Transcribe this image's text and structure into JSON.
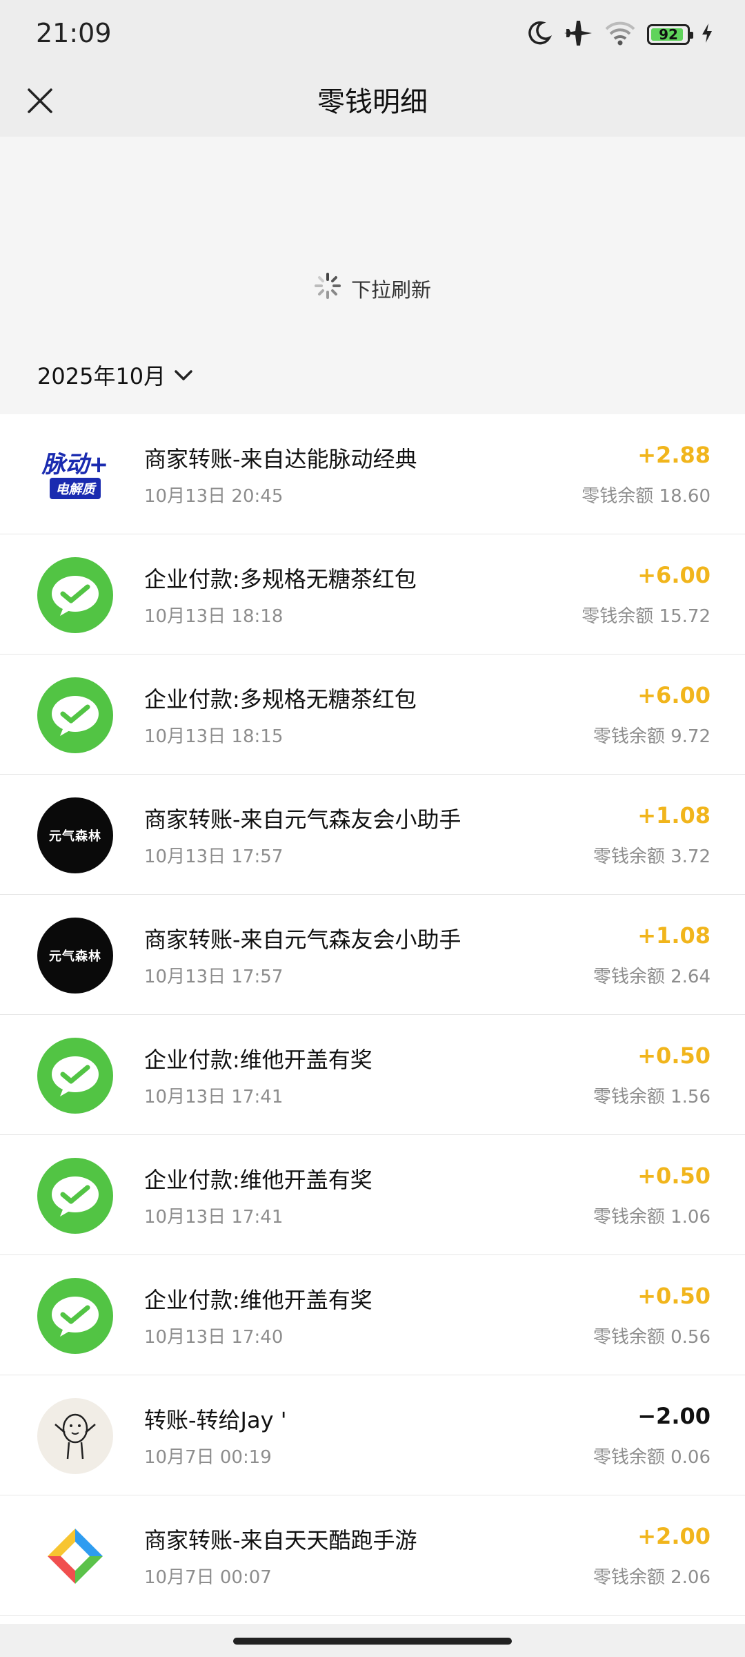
{
  "status_bar": {
    "time": "21:09",
    "battery": "92",
    "icons": [
      "moon-icon",
      "airplane-icon",
      "wifi-icon",
      "battery-icon",
      "charging-icon"
    ]
  },
  "header": {
    "title": "零钱明细",
    "close_icon": "close-icon"
  },
  "pull_refresh": {
    "label": "下拉刷新"
  },
  "filter": {
    "month": "2025年10月"
  },
  "colors": {
    "income": "#f1b51c",
    "expense": "#111111",
    "wechat_green": "#52c444"
  },
  "transactions": [
    {
      "title": "商家转账-来自达能脉动经典",
      "time": "10月13日 20:45",
      "amount": "+2.88",
      "balance": "零钱余额 18.60",
      "avatar": "pulse-logo",
      "avatar_text": "脉动+",
      "avatar_sub": "电解质"
    },
    {
      "title": "企业付款:多规格无糖茶红包",
      "time": "10月13日 18:18",
      "amount": "+6.00",
      "balance": "零钱余额 15.72",
      "avatar": "wechat-icon"
    },
    {
      "title": "企业付款:多规格无糖茶红包",
      "time": "10月13日 18:15",
      "amount": "+6.00",
      "balance": "零钱余额 9.72",
      "avatar": "wechat-icon"
    },
    {
      "title": "商家转账-来自元气森友会小助手",
      "time": "10月13日 17:57",
      "amount": "+1.08",
      "balance": "零钱余额 3.72",
      "avatar": "genki-forest-logo",
      "avatar_text": "元气森林"
    },
    {
      "title": "商家转账-来自元气森友会小助手",
      "time": "10月13日 17:57",
      "amount": "+1.08",
      "balance": "零钱余额 2.64",
      "avatar": "genki-forest-logo",
      "avatar_text": "元气森林"
    },
    {
      "title": "企业付款:维他开盖有奖",
      "time": "10月13日 17:41",
      "amount": "+0.50",
      "balance": "零钱余额 1.56",
      "avatar": "wechat-icon"
    },
    {
      "title": "企业付款:维他开盖有奖",
      "time": "10月13日 17:41",
      "amount": "+0.50",
      "balance": "零钱余额 1.06",
      "avatar": "wechat-icon"
    },
    {
      "title": "企业付款:维他开盖有奖",
      "time": "10月13日 17:40",
      "amount": "+0.50",
      "balance": "零钱余额 0.56",
      "avatar": "wechat-icon"
    },
    {
      "title": "转账-转给Jay '",
      "time": "10月7日 00:19",
      "amount": "−2.00",
      "balance": "零钱余额 0.06",
      "avatar": "doodle-avatar"
    },
    {
      "title": "商家转账-来自天天酷跑手游",
      "time": "10月7日 00:07",
      "amount": "+2.00",
      "balance": "零钱余额 2.06",
      "avatar": "game-logo"
    }
  ]
}
